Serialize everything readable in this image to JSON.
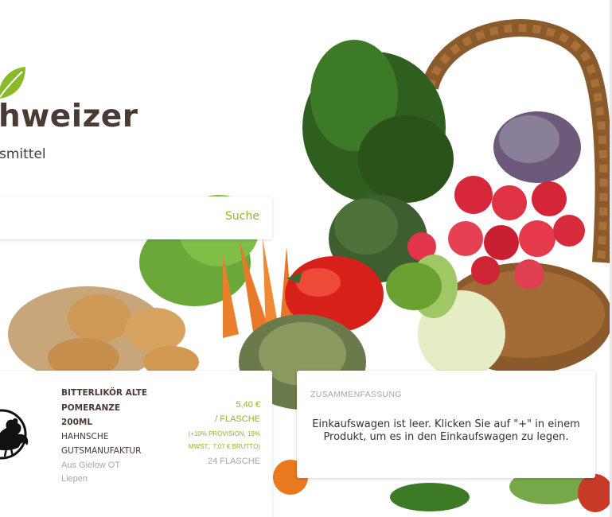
{
  "header": {
    "logo_title": "hweizer",
    "logo_subtitle": "smittel"
  },
  "search": {
    "placeholder": "",
    "button_label": "Suche"
  },
  "product": {
    "name_lines": [
      "BITTERLIKÖR ALTE",
      "POMERANZE",
      "200ML"
    ],
    "producer_lines": [
      "HAHNSCHE",
      "GUTSMANUFAKTUR"
    ],
    "location_lines": [
      "Aus Gielow OT",
      "Liepen"
    ],
    "price": "5,40 €",
    "unit": "/ FLASCHE",
    "note_lines": [
      "(+10% PROVISION, 19%",
      "MWST., 7,07 € BRUTTO)"
    ],
    "stock": "24 FLASCHE",
    "logo_icon": "rooster-icon"
  },
  "cart_summary": {
    "title": "ZUSAMMENFASSUNG",
    "message": "Einkaufswagen ist leer. Klicken Sie auf \"+\" in einem Produkt, um es in den Einkaufswagen zu legen."
  },
  "colors": {
    "brand_green": "#8aba2a",
    "brand_brown": "#4b3a33",
    "muted_gray": "#a8a8a8"
  }
}
